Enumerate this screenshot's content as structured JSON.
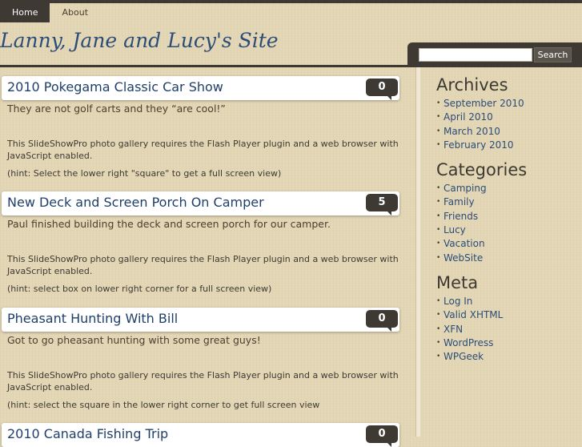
{
  "nav": {
    "items": [
      {
        "label": "Home",
        "active": true
      },
      {
        "label": "About",
        "active": false
      }
    ]
  },
  "site": {
    "title": "Lanny, Jane and Lucy's Site"
  },
  "search": {
    "button_label": "Search",
    "value": "",
    "placeholder": ""
  },
  "posts": [
    {
      "title": "2010 Pokegama Classic Car Show",
      "comments": "0",
      "excerpt": "They are not golf carts and they “are cool!”",
      "flash_notice": "This SlideShowPro photo gallery requires the Flash Player plugin and a web browser with JavaScript enabled.",
      "hint": "(hint: Select the lower right \"square\" to get a full screen view)"
    },
    {
      "title": "New Deck and Screen Porch On Camper",
      "comments": "5",
      "excerpt": "Paul finished building the deck and screen porch for our camper.",
      "flash_notice": "This SlideShowPro photo gallery requires the Flash Player plugin and a web browser with JavaScript enabled.",
      "hint": "(hint: select box on lower right corner for a full screen view)"
    },
    {
      "title": "Pheasant Hunting With Bill",
      "comments": "0",
      "excerpt": "Got to go pheasant hunting with some great guys!",
      "flash_notice": "This SlideShowPro photo gallery requires the Flash Player plugin and a web browser with JavaScript enabled.",
      "hint": "(hint: select the square in the lower right corner to get full screen view"
    },
    {
      "title": "2010 Canada Fishing Trip",
      "comments": "0"
    }
  ],
  "sidebar": {
    "archives": {
      "title": "Archives",
      "items": [
        "September 2010",
        "April 2010",
        "March 2010",
        "February 2010"
      ]
    },
    "categories": {
      "title": "Categories",
      "items": [
        "Camping",
        "Family",
        "Friends",
        "Lucy",
        "Vacation",
        "WebSite"
      ]
    },
    "meta": {
      "title": "Meta",
      "items": [
        "Log In",
        "Valid XHTML",
        "XFN",
        "WordPress",
        "WPGeek"
      ]
    }
  },
  "colors": {
    "accent_dark": "#3e3a33",
    "link_blue": "#2c4d78",
    "background": "#e2d6b5"
  }
}
